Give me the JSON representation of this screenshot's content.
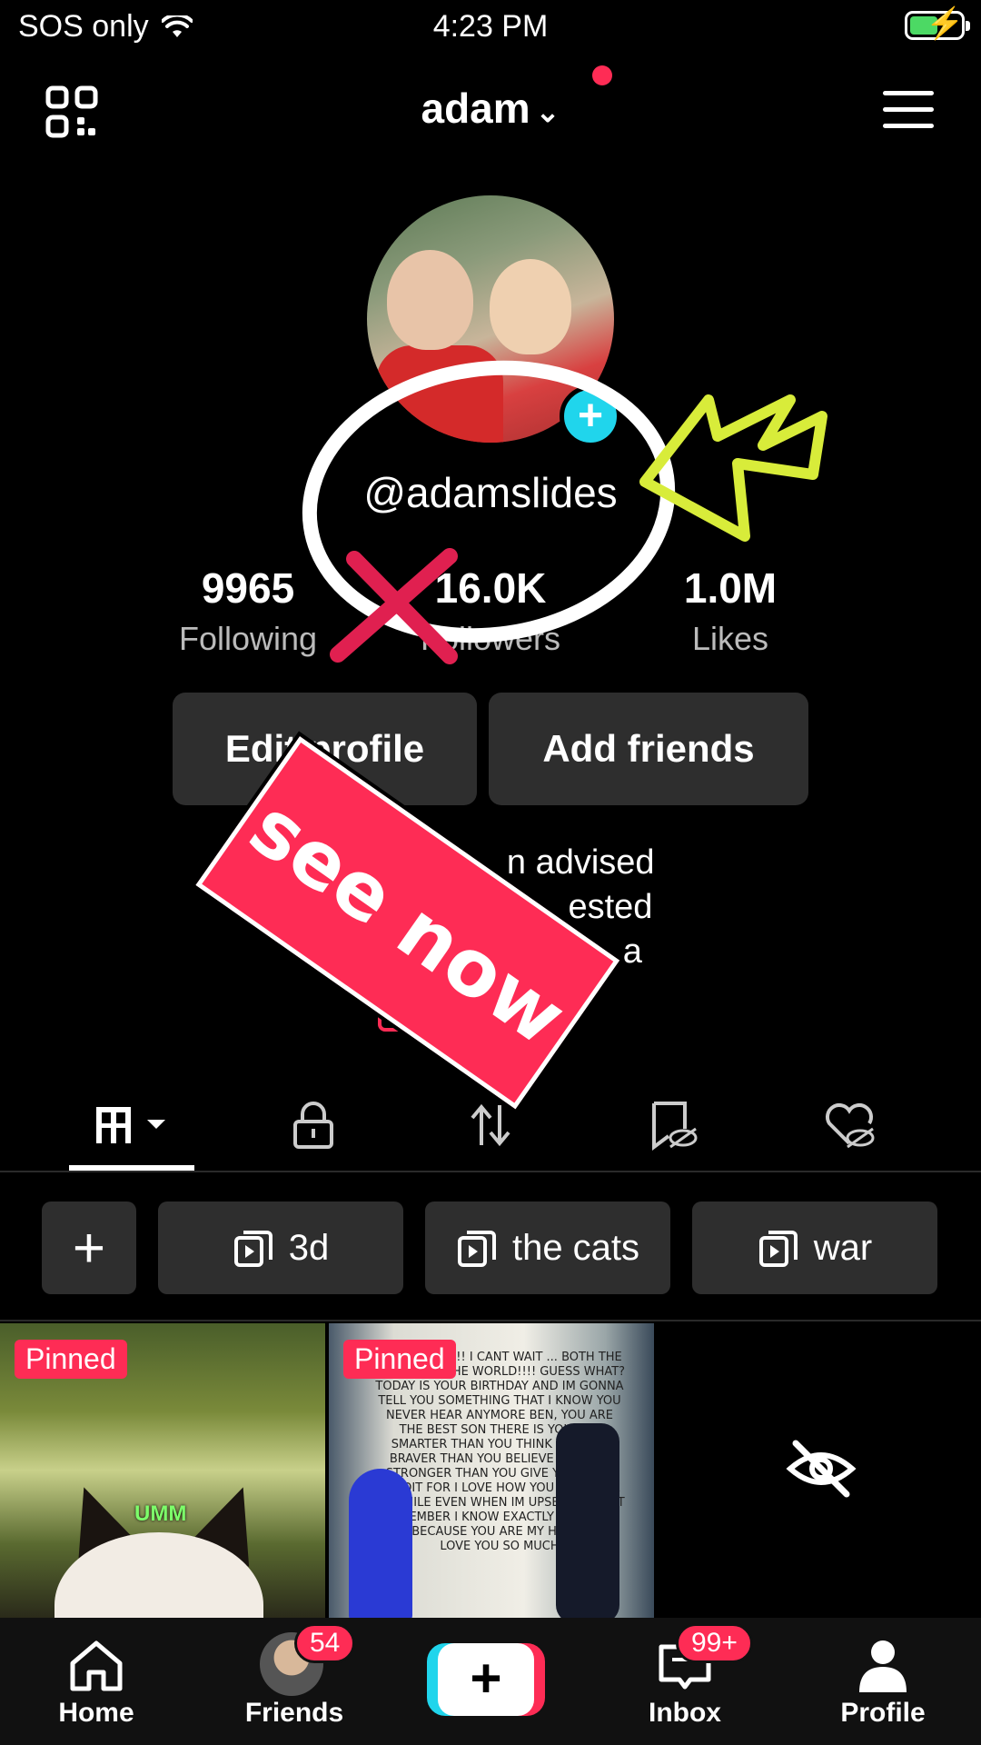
{
  "status_bar": {
    "carrier": "SOS only",
    "time": "4:23 PM",
    "battery_color": "#4cd964"
  },
  "header": {
    "username": "adam",
    "handle": "@adamslides"
  },
  "stats": {
    "following": {
      "value": "9965",
      "label": "Following"
    },
    "followers": {
      "value": "16.0K",
      "label": "Followers"
    },
    "likes": {
      "value": "1.0M",
      "label": "Likes"
    }
  },
  "buttons": {
    "edit_profile": "Edit profile",
    "add_friends": "Add friends"
  },
  "bio": {
    "line1": "v                 n advised",
    "line2": "m                      ested",
    "line3": "I love                     a",
    "add_link": "A"
  },
  "sticker": {
    "text": "see now"
  },
  "tabs": [
    "videos-grid-icon",
    "private-lock-icon",
    "repost-icon",
    "saved-icon",
    "liked-icon"
  ],
  "collections": [
    {
      "label": "3d"
    },
    {
      "label": "the cats"
    },
    {
      "label": "war"
    }
  ],
  "videos": [
    {
      "badge": "Pinned",
      "caption": "UMM"
    },
    {
      "badge": "Pinned",
      "note": "BEN ... MUCH!! I CANT WAIT ... BOTH THE BIGGEST ... THE WORLD!!!! GUESS WHAT? TODAY IS YOUR BIRTHDAY AND IM GONNA TELL YOU SOMETHING THAT I KNOW YOU NEVER HEAR ANYMORE BEN, YOU ARE THE BEST SON THERE IS YOU ARE SMARTER THAN YOU THINK YOU ARE BRAVER THAN YOU BELIEVE YOU ARE STRONGER THAN YOU GIVE YOURSELF CREDIT FOR I LOVE HOW YOU CAN MAKE ME SMILE EVEN WHEN IM UPSET BUT JUST REMEMBER I KNOW EXACTLY WHO YOU ARE BECAUSE YOU ARE MY HEART BEN LOVE YOU SO MUCH"
    },
    {
      "hidden": true
    }
  ],
  "bottom_nav": {
    "home": "Home",
    "friends": "Friends",
    "friends_badge": "54",
    "inbox": "Inbox",
    "inbox_badge": "99+",
    "profile": "Profile"
  },
  "colors": {
    "accent": "#fe2c55",
    "cyan": "#20d5ec",
    "annotation_yellow": "#d8ec3a"
  }
}
